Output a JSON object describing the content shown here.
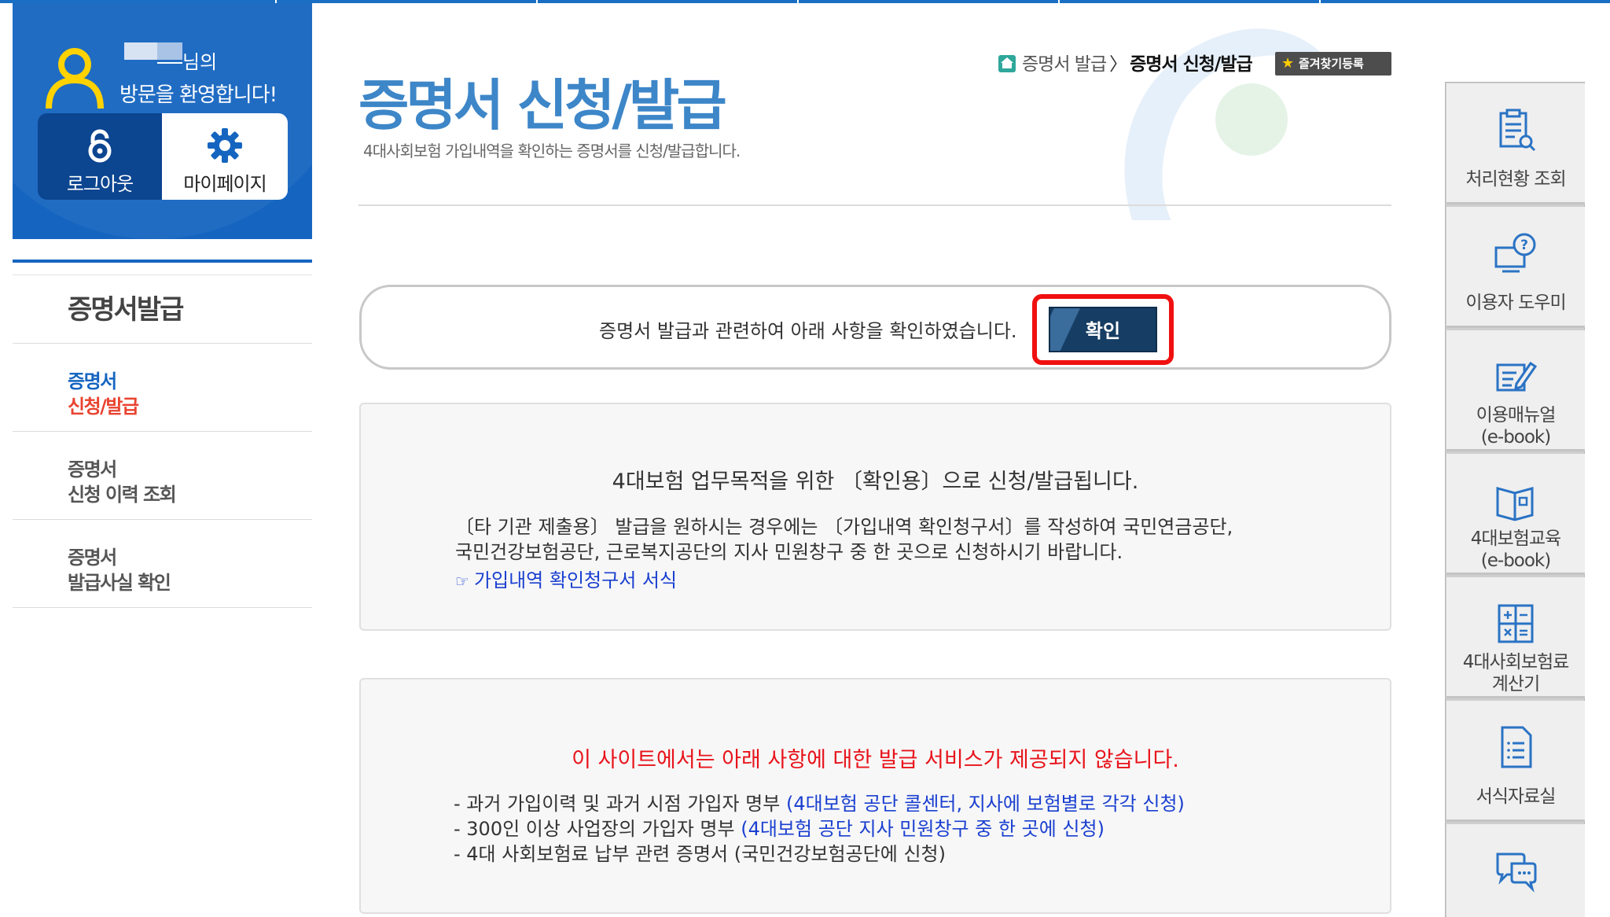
{
  "user": {
    "name_suffix": "님의",
    "welcome": "방문을 환영합니다!",
    "logout_label": "로그아웃",
    "mypage_label": "마이페이지"
  },
  "sidebar": {
    "title": "증명서발급",
    "items": [
      {
        "line1": "증명서",
        "line2": "신청/발급",
        "active": true
      },
      {
        "line1": "증명서",
        "line2": "신청 이력 조회",
        "active": false
      },
      {
        "line1": "증명서",
        "line2": "발급사실 확인",
        "active": false
      }
    ]
  },
  "header": {
    "title": "증명서 신청/발급",
    "description": "4대사회보험 가입내역을 확인하는 증명서를 신청/발급합니다.",
    "breadcrumb": {
      "parent": "증명서 발급",
      "separator": "〉",
      "current": "증명서 신청/발급"
    },
    "favorite_label": "즐겨찾기등록"
  },
  "confirm": {
    "text": "증명서 발급과 관련하여 아래 사항을 확인하였습니다.",
    "button_label": "확인"
  },
  "notice1": {
    "title": "4대보험 업무목적을 위한 〔확인용〕으로 신청/발급됩니다.",
    "body_line1": "〔타 기관 제출용〕 발급을 원하시는 경우에는 〔가입내역 확인청구서〕를 작성하여 국민연금공단,",
    "body_line2": "국민건강보험공단, 근로복지공단의 지사 민원창구 중 한 곳으로 신청하시기 바랍니다.",
    "link_icon": "☞",
    "link_label": "가입내역 확인청구서 서식"
  },
  "notice2": {
    "title": "이 사이트에서는 아래 사항에 대한 발급 서비스가 제공되지 않습니다.",
    "items": [
      {
        "text": "- 과거 가입이력 및 과거 시점 가입자 명부 ",
        "note": "(4대보험 공단 콜센터, 지사에 보험별로 각각 신청)"
      },
      {
        "text": "- 300인 이상 사업장의 가입자 명부 ",
        "note": "(4대보험 공단 지사 민원창구 중 한 곳에 신청)"
      },
      {
        "text": "- 4대 사회보험료 납부 관련 증명서 (국민건강보험공단에 신청)",
        "note": ""
      }
    ]
  },
  "quick_menu": {
    "items": [
      {
        "line1": "처리현황 조회",
        "line2": "",
        "icon": "clipboard-search-icon"
      },
      {
        "line1": "이용자 도우미",
        "line2": "",
        "icon": "computer-help-icon"
      },
      {
        "line1": "이용매뉴얼",
        "line2": "(e-book)",
        "icon": "edit-note-icon"
      },
      {
        "line1": "4대보험교육",
        "line2": "(e-book)",
        "icon": "open-book-icon"
      },
      {
        "line1": "4대사회보험료",
        "line2": "계산기",
        "icon": "calculator-icon"
      },
      {
        "line1": "서식자료실",
        "line2": "",
        "icon": "document-icon"
      },
      {
        "line1": "",
        "line2": "",
        "icon": "chat-bubble-icon"
      }
    ]
  },
  "colors": {
    "brand_blue": "#1565c0",
    "title_blue": "#3d86c8",
    "active_red": "#e94330",
    "alert_red": "#e8131b",
    "link_blue": "#1a3fd0",
    "confirm_button": "#163d63"
  }
}
